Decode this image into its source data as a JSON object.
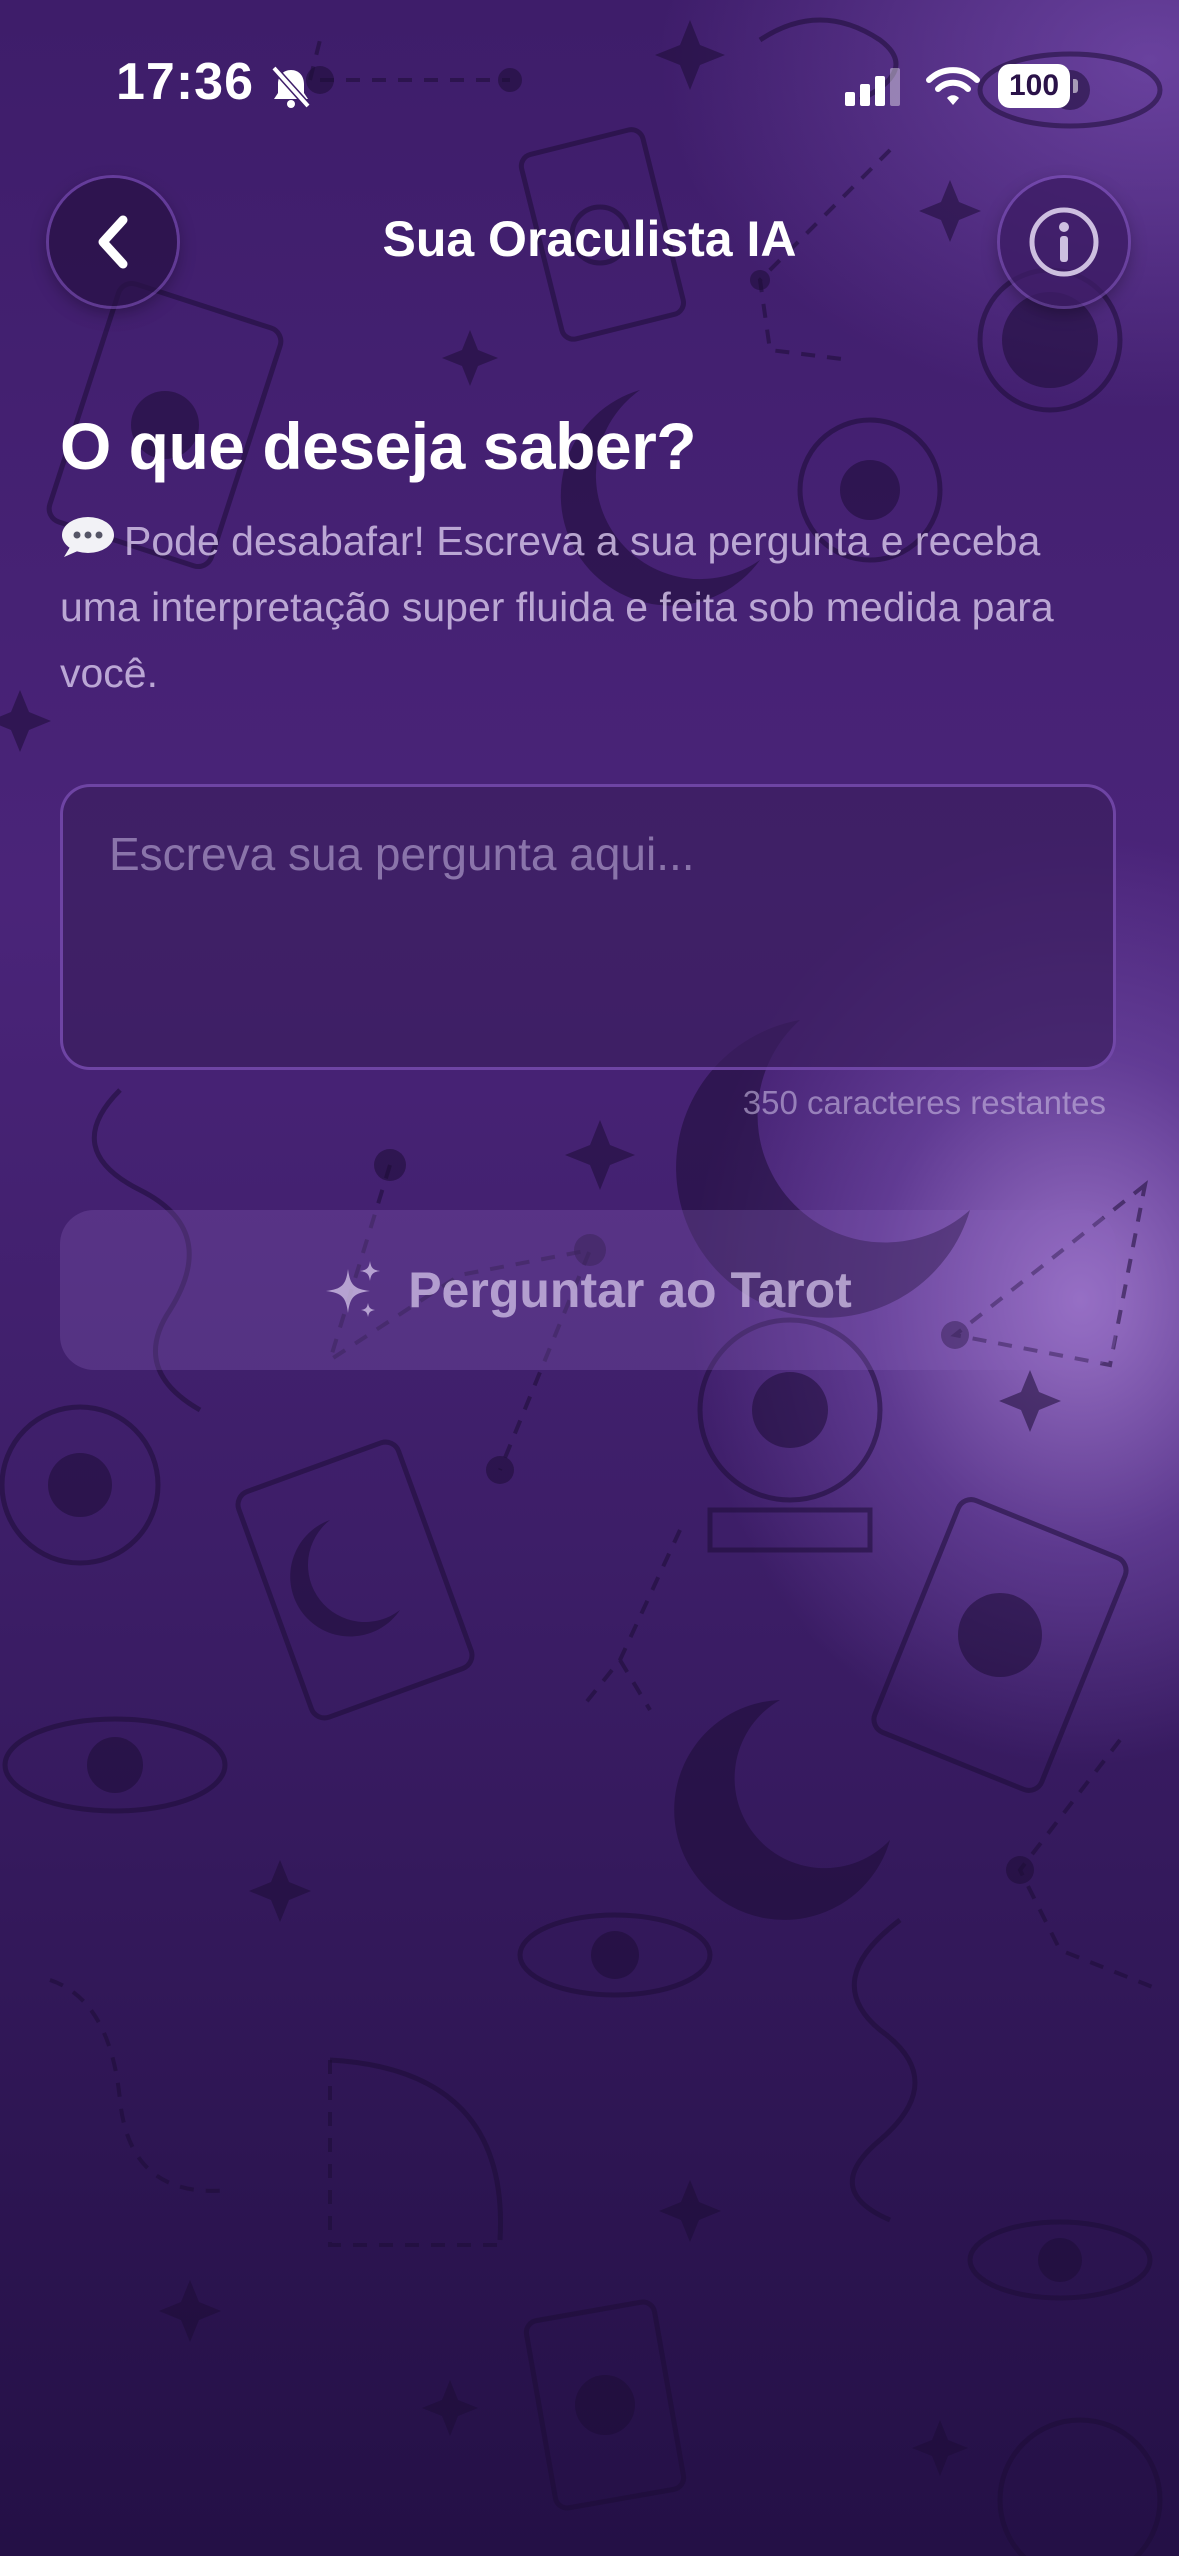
{
  "status_bar": {
    "time": "17:36",
    "battery": "100",
    "icons": [
      "bell-slash-icon",
      "cellular-signal-icon",
      "wifi-icon",
      "battery-icon"
    ]
  },
  "header": {
    "title": "Sua Oraculista IA",
    "back_icon": "chevron-left-icon",
    "info_icon": "info-circle-icon"
  },
  "content": {
    "heading": "O que deseja saber?",
    "subtitle_emoji": "speech-bubble-icon",
    "subtitle": "Pode desabafar! Escreva a sua pergunta e receba uma interpretação super fluida e feita sob medida para você.",
    "question_input": {
      "placeholder": "Escreva sua pergunta aqui...",
      "value": ""
    },
    "char_counter": "350 caracteres restantes",
    "ask_button": {
      "label": "Perguntar ao Tarot",
      "icon": "sparkles-icon"
    }
  },
  "colors": {
    "background_top": "#3e1d6a",
    "background_bottom": "#241046",
    "glow": "#aa82d7",
    "accent": "#9664dc"
  }
}
